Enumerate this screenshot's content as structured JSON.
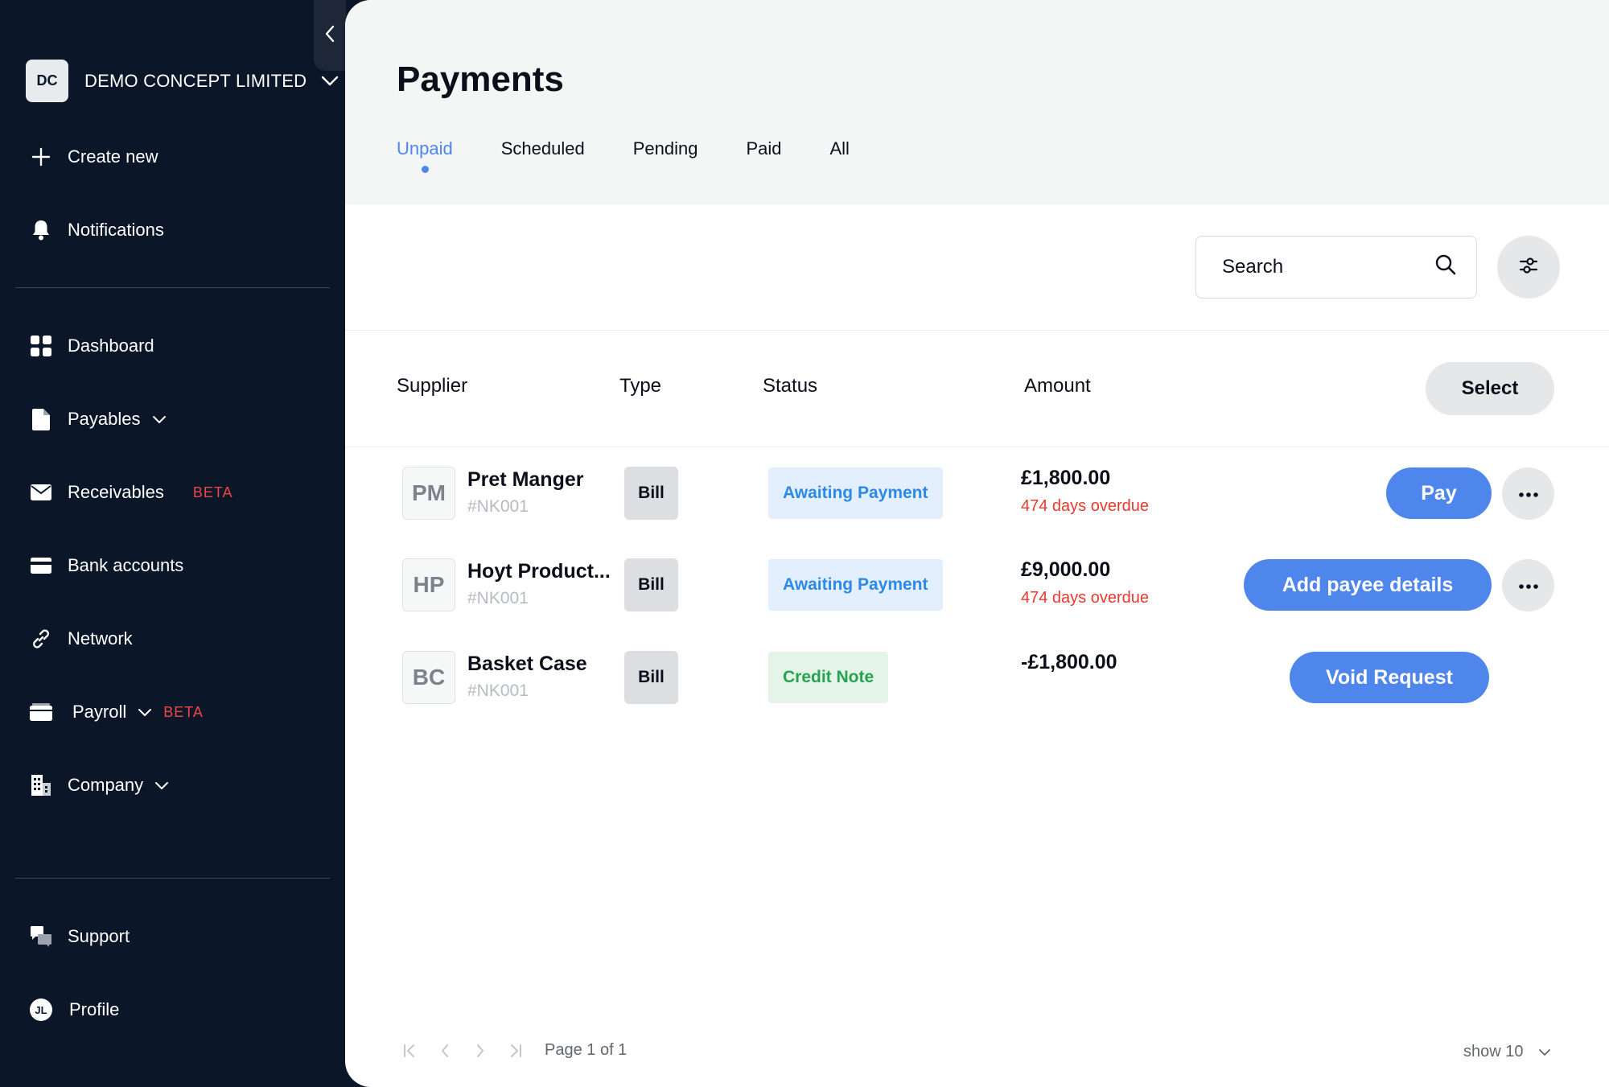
{
  "sidebar": {
    "org": {
      "initials": "DC",
      "name": "DEMO CONCEPT LIMITED"
    },
    "create_new": "Create new",
    "notifications": "Notifications",
    "items": [
      {
        "label": "Dashboard",
        "icon": "dashboard-icon"
      },
      {
        "label": "Payables",
        "icon": "document-icon",
        "has_dropdown": true
      },
      {
        "label": "Receivables",
        "icon": "envelope-icon",
        "badge": "BETA"
      },
      {
        "label": "Bank accounts",
        "icon": "card-icon"
      },
      {
        "label": "Network",
        "icon": "link-icon"
      },
      {
        "label": "Payroll",
        "icon": "wallet-icon",
        "has_dropdown": true,
        "badge": "BETA"
      },
      {
        "label": "Company",
        "icon": "building-icon",
        "has_dropdown": true
      }
    ],
    "support": "Support",
    "profile": {
      "initials": "JL",
      "label": "Profile"
    }
  },
  "page": {
    "title": "Payments",
    "tabs": [
      "Unpaid",
      "Scheduled",
      "Pending",
      "Paid",
      "All"
    ],
    "active_tab": "Unpaid"
  },
  "search": {
    "placeholder": "Search"
  },
  "table": {
    "headers": {
      "supplier": "Supplier",
      "type": "Type",
      "status": "Status",
      "amount": "Amount"
    },
    "select_label": "Select",
    "rows": [
      {
        "initials": "PM",
        "name": "Pret Manger",
        "ref": "#NK001",
        "type": "Bill",
        "status": "Awaiting Payment",
        "amount": "£1,800.00",
        "overdue": "474 days overdue",
        "action": "Pay"
      },
      {
        "initials": "HP",
        "name": "Hoyt Product...",
        "ref": "#NK001",
        "type": "Bill",
        "status": "Awaiting Payment",
        "amount": "£9,000.00",
        "overdue": "474 days overdue",
        "action": "Add payee details"
      },
      {
        "initials": "BC",
        "name": "Basket Case",
        "ref": "#NK001",
        "type": "Bill",
        "status": "Credit Note",
        "amount": "-£1,800.00",
        "overdue": "",
        "action": "Void Request"
      }
    ]
  },
  "pagination": {
    "page_label": "Page 1 of 1",
    "show_label": "show 10"
  },
  "colors": {
    "sidebar_bg": "#0b1628",
    "accent": "#4f86ec",
    "overdue": "#e8392f",
    "awaiting": "#2c8ae6",
    "credit": "#25a352",
    "beta": "#f04646"
  }
}
